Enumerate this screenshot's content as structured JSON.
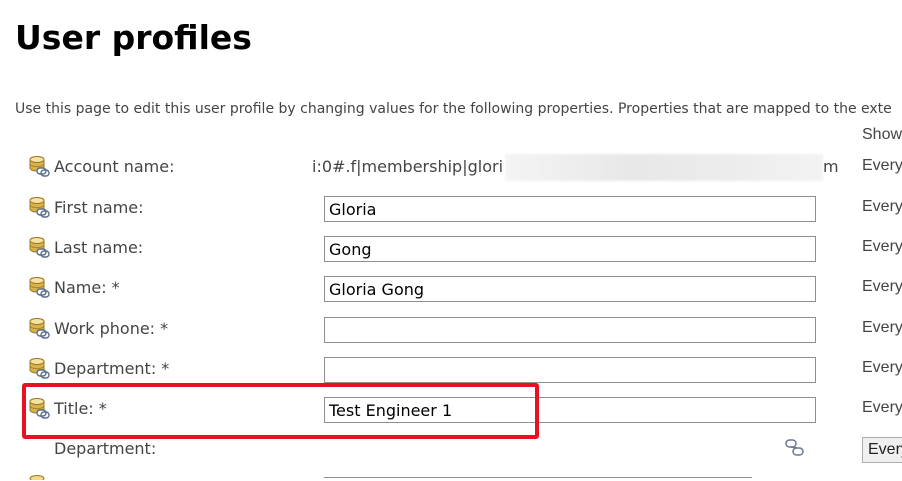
{
  "page": {
    "title": "User profiles",
    "description": "Use this page to edit this user profile by changing values for the following properties. Properties that are mapped to the exte"
  },
  "columns": {
    "show_to_header": "Show"
  },
  "colors": {
    "highlight": "#e81123",
    "icon_gold": "#d8b24a",
    "input_border": "#8f8f8f"
  },
  "icons": {
    "property_icon": "database-link-icon",
    "policy_icon": "link-icon"
  },
  "account": {
    "label": "Account name:",
    "value_visible_start": "i:0#.f|membership|glori",
    "value_visible_end": "m",
    "privacy": "Every"
  },
  "fields": [
    {
      "label": "First name:",
      "value": "Gloria",
      "privacy": "Every"
    },
    {
      "label": "Last name:",
      "value": "Gong",
      "privacy": "Every"
    },
    {
      "label": "Name: *",
      "value": "Gloria Gong",
      "privacy": "Every"
    },
    {
      "label": "Work phone: *",
      "value": "",
      "privacy": "Every"
    },
    {
      "label": "Department: *",
      "value": "",
      "privacy": "Every"
    },
    {
      "label": "Title: *",
      "value": "Test Engineer 1",
      "privacy": "Every"
    }
  ],
  "department_row": {
    "label": "Department:",
    "privacy_selected": "Every"
  }
}
